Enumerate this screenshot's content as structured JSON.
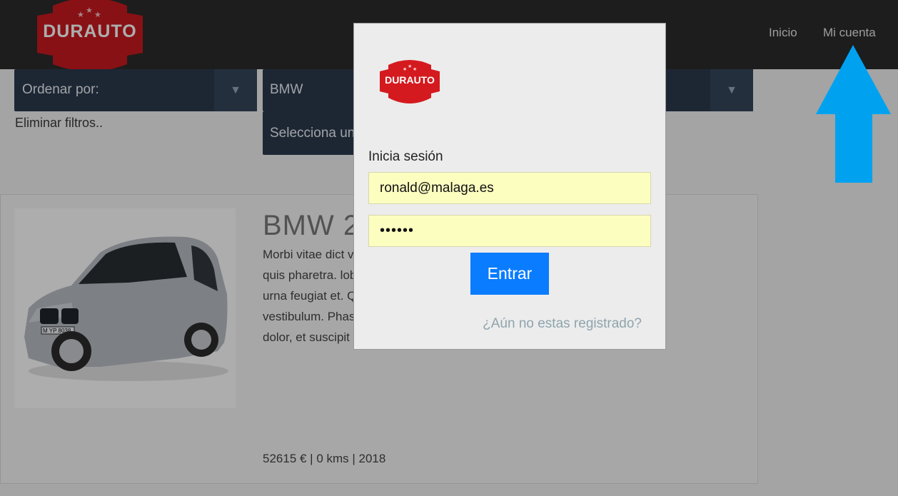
{
  "brand": {
    "logo_text": "DURAUTO",
    "logo_color": "#c91a1f"
  },
  "nav": {
    "home": "Inicio",
    "account": "Mi cuenta"
  },
  "filters": {
    "order_label": "Ordenar por:",
    "brand_value": "BMW",
    "model_placeholder": "Selecciona un",
    "clear": "Eliminar filtros..",
    "arrow": "▼"
  },
  "listing": {
    "title": "BMW 2",
    "description": "Morbi vitae dict vel elementum rhoncus. Nam placerat moles quis pharetra. lobortis. Sed hendrerit lorem risus, sed congue urna feugiat et. Quisque consequat ullamcorper odio eget vestibulum. Phasellus vel est nunc. Pellentesque aliquet odio dolor, et suscipit nisl posuere id.",
    "plate": "M YP 8038",
    "meta": "52615 € | 0 kms | 2018"
  },
  "login": {
    "heading": "Inicia sesión",
    "email": "ronald@malaga.es",
    "password": "••••••",
    "submit": "Entrar",
    "register": "¿Aún no estas registrado?"
  },
  "colors": {
    "header_bg": "#2b2b2b",
    "select_bg": "#2b3a4d",
    "button_blue": "#0a7cff",
    "annotation_arrow": "#00a2f0",
    "autofill_yellow": "#fcfec0"
  }
}
